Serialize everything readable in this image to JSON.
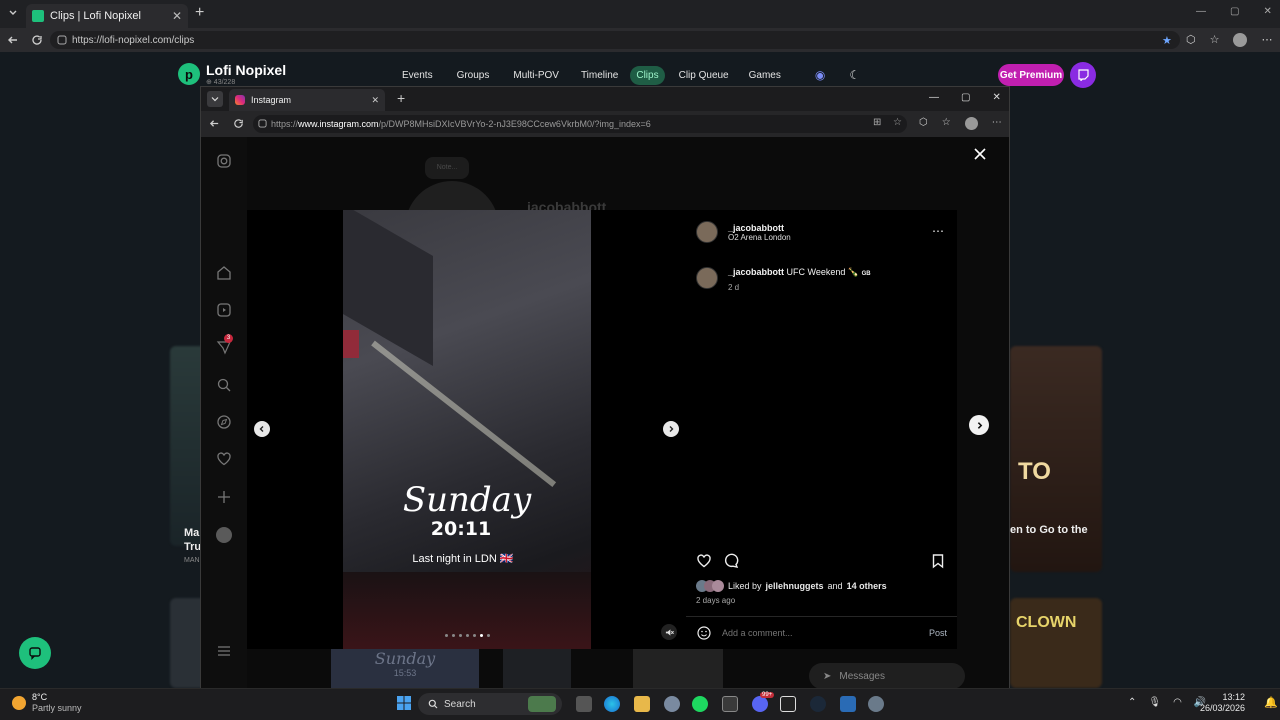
{
  "outer_browser": {
    "tab_title": "Clips | Lofi Nopixel",
    "url": "https://lofi-nopixel.com/clips"
  },
  "site": {
    "name": "Lofi Nopixel",
    "stats": "⊕ 43/228",
    "nav": [
      "Events",
      "Groups",
      "Multi-POV",
      "Timeline",
      "Clips",
      "Clip Queue",
      "Games"
    ],
    "active_nav": "Clips",
    "premium_label": "Get Premium",
    "bg_card_left_title_1": "Ma",
    "bg_card_left_title_2": "Tru",
    "bg_card_left_meta": "MAN",
    "bg_card_right_title": "en to Go to the",
    "bg_card_right_overlay": "TO",
    "bg_thumb_text": "CLOWN"
  },
  "inner_window": {
    "tab_title": "Instagram",
    "url_prefix": "https://",
    "url_host": "www.instagram.com",
    "url_path": "/p/DWP8MHsiDXIcVBVrYo-2-nJ3E98CCcew6VkrbM0/?img_index=6"
  },
  "instagram": {
    "bg_note": "Note...",
    "bg_username": "jacobabbott",
    "sidebar_badge": "3",
    "post": {
      "author": "_jacobabbott",
      "location": "O2 Arena London",
      "caption_author": "_jacobabbott",
      "caption_text": "UFC Weekend 🍾",
      "caption_flag": "GB",
      "caption_age": "2 d",
      "overlay_day": "Sunday",
      "overlay_time": "20:11",
      "overlay_caption": "Last night in LDN 🇬🇧",
      "liked_by_prefix": "Liked by",
      "liked_by_user": "jellehnuggets",
      "liked_by_and": "and",
      "liked_by_others": "14 others",
      "posted_ago": "2 days ago",
      "comment_placeholder": "Add a comment...",
      "post_button": "Post",
      "carousel_count": 7,
      "carousel_index": 6
    },
    "bottom_thumb_text": "Sunday",
    "bottom_thumb_time": "15:53",
    "messages_label": "Messages",
    "messages_badge": "3"
  },
  "taskbar": {
    "weather_temp": "8°C",
    "weather_desc": "Partly sunny",
    "search_placeholder": "Search",
    "time": "13:12",
    "date": "26/03/2026",
    "discord_badge": "99+"
  },
  "colors": {
    "accent_green": "#1ec07c",
    "premium_pink": "#c11fb0",
    "twitch_purple": "#8a2be2"
  }
}
